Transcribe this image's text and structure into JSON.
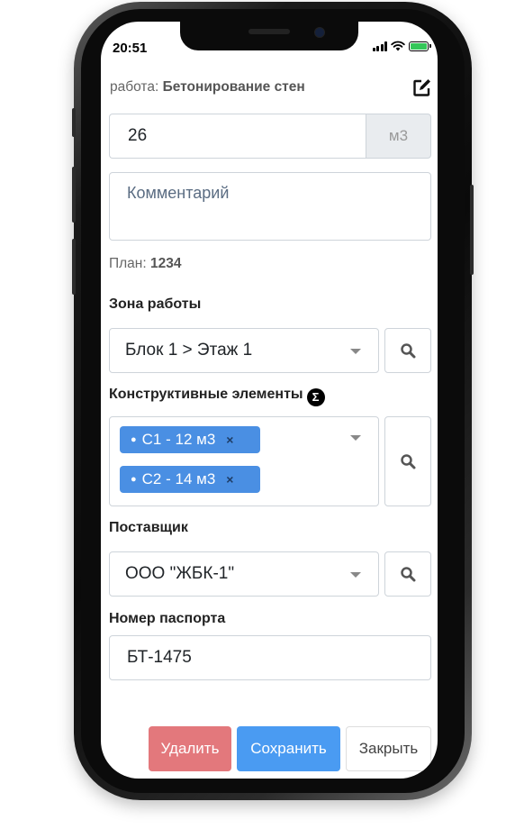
{
  "status": {
    "time": "20:51"
  },
  "work": {
    "prefix": "работа:",
    "name": "Бетонирование стен"
  },
  "quantity": {
    "value": "26",
    "unit": "м3"
  },
  "comment": {
    "placeholder": "Комментарий"
  },
  "plan": {
    "label": "План:",
    "value": "1234"
  },
  "zone": {
    "label": "Зона работы",
    "selected": "Блок 1 > Этаж 1"
  },
  "elements": {
    "label": "Конструктивные элементы",
    "sigma": "Σ",
    "tags": [
      {
        "label": "С1 - 12 м3"
      },
      {
        "label": "С2 - 14 м3"
      }
    ],
    "tag_bullet": "●",
    "tag_remove": "×"
  },
  "supplier": {
    "label": "Поставщик",
    "selected": "ООО \"ЖБК-1\""
  },
  "passport": {
    "label": "Номер паспорта",
    "value": "БТ-1475"
  },
  "buttons": {
    "delete": "Удалить",
    "save": "Сохранить",
    "close": "Закрыть"
  },
  "icons": {
    "edit": "edit-icon",
    "search": "search-icon",
    "sigma": "sigma-icon",
    "signal": "signal-icon",
    "wifi": "wifi-icon",
    "battery": "battery-icon"
  },
  "colors": {
    "tag": "#4a8fe3",
    "save": "#4a9bf2",
    "delete": "#e3787c",
    "battery": "#34c759"
  }
}
